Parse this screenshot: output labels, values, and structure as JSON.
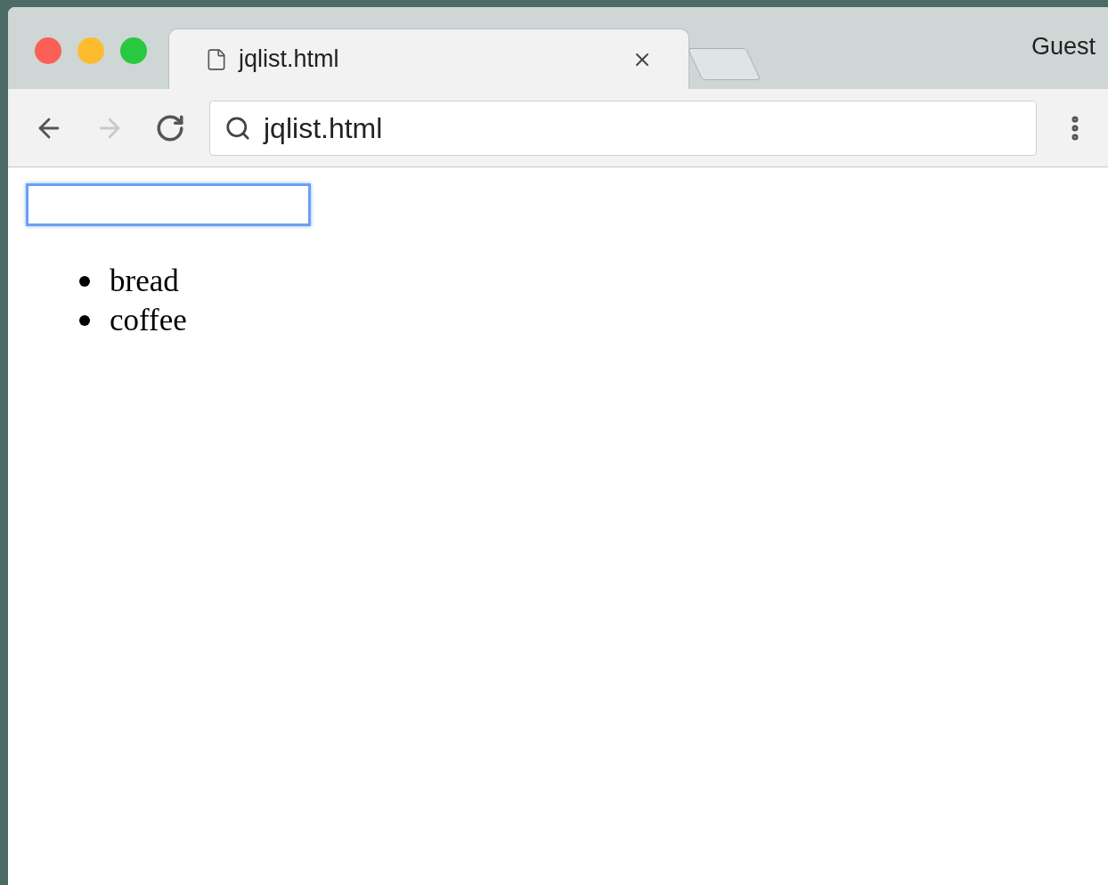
{
  "tab": {
    "title": "jqlist.html",
    "selected": true
  },
  "profile": "Guest",
  "nav": [
    {
      "kind": "back",
      "disabled": false
    },
    {
      "kind": "forward",
      "disabled": true
    },
    {
      "kind": "reload",
      "disabled": false
    }
  ],
  "address": "jqlist.html",
  "page": {
    "input": {
      "focused": true
    },
    "items": [
      "bread",
      "coffee"
    ]
  }
}
